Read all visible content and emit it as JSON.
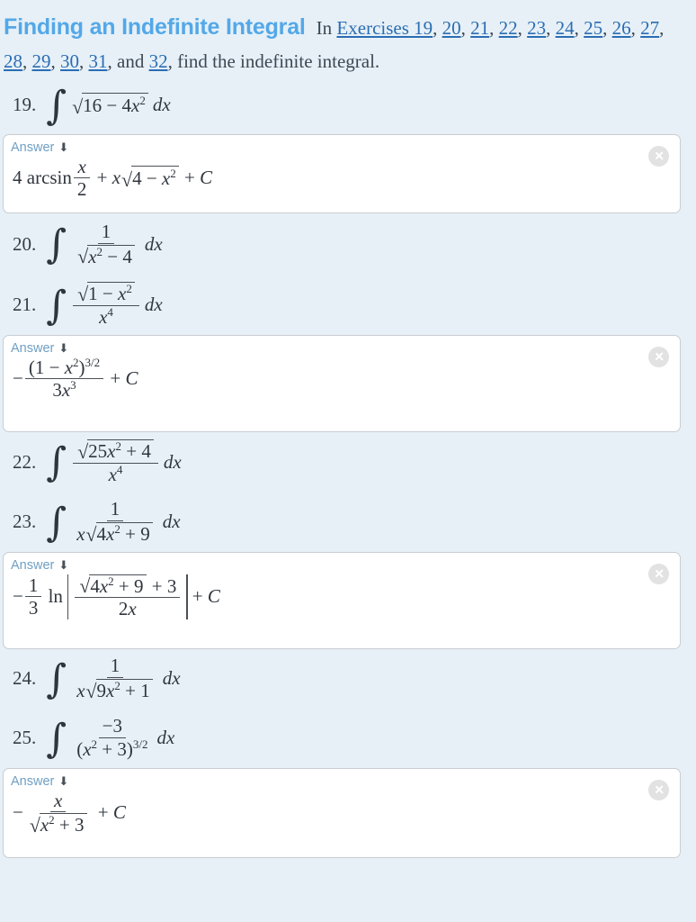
{
  "header": {
    "section_title": "Finding an Indefinite Integral",
    "lead_in": "In",
    "exercises_link_text": "Exercises 19",
    "exercise_links": [
      "20",
      "21",
      "22",
      "23",
      "24",
      "25",
      "26",
      "27",
      "28",
      "29",
      "30",
      "31"
    ],
    "conjunction": "and",
    "last_link": "32",
    "tail_text": "find the indefinite integral.",
    "comma": ",",
    "title_color": "#53a8e8",
    "link_color": "#2a6db3",
    "text_color": "#3d4852"
  },
  "page": {
    "background_color": "#e7f0f7",
    "answer_box_background": "#ffffff",
    "answer_box_border_color": "#c9cdd2",
    "answer_label_color": "#6f9fc4"
  },
  "answer_ui": {
    "label": "Answer",
    "arrow_glyph": "⬇",
    "close_icon_name": "close-icon"
  },
  "exercises": [
    {
      "number": "19.",
      "integrand_tex": "sqrt(16 - 4x^2) dx"
    },
    {
      "number": "20.",
      "integrand_tex": "1 / sqrt(x^2 - 4) dx"
    },
    {
      "number": "21.",
      "integrand_tex": "sqrt(1 - x^2) / x^4 dx"
    },
    {
      "number": "22.",
      "integrand_tex": "sqrt(25x^2 + 4) / x^4 dx"
    },
    {
      "number": "23.",
      "integrand_tex": "1 / (x sqrt(4x^2 + 9)) dx"
    },
    {
      "number": "24.",
      "integrand_tex": "1 / (x sqrt(9x^2 + 1)) dx"
    },
    {
      "number": "25.",
      "integrand_tex": "-3 / (x^2 + 3)^(3/2) dx"
    }
  ],
  "answers": [
    {
      "for_exercise": "19",
      "expression_tex": "4 arcsin(x/2) + x sqrt(4 - x^2) + C"
    },
    {
      "for_exercise": "21",
      "expression_tex": "-(1 - x^2)^(3/2) / (3x^3) + C"
    },
    {
      "for_exercise": "23",
      "expression_tex": "-(1/3) ln | (sqrt(4x^2 + 9) + 3) / (2x) | + C"
    },
    {
      "for_exercise": "25",
      "expression_tex": "-x / sqrt(x^2 + 3) + C"
    }
  ],
  "symbols": {
    "integral": "∫",
    "radical": "√",
    "minus": "−",
    "plus": "+",
    "constant": "C",
    "differential": "dx",
    "arcsin": "arcsin",
    "ln": "ln"
  },
  "numbers": {
    "n1": "1",
    "n2": "2",
    "n3": "3",
    "n4": "4",
    "n9": "9",
    "n16": "16",
    "n25": "25",
    "neg3": "−3",
    "exp2": "2",
    "exp3": "3",
    "exp4": "4",
    "exp32": "3/2"
  },
  "vars": {
    "x": "x"
  }
}
